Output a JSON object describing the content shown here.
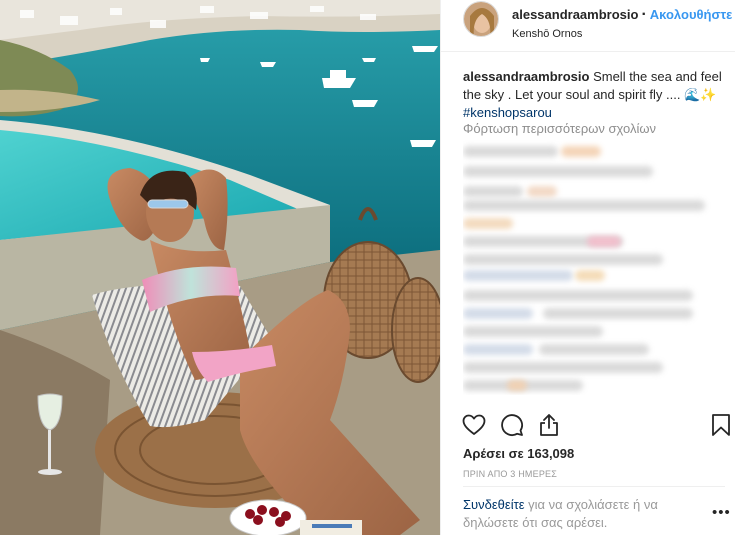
{
  "post": {
    "username": "alessandraambrosio",
    "follow_label": "Ακολουθήστε",
    "location": "Kenshō Ornos",
    "caption_user": "alessandraambrosio",
    "caption_text": "Smell the sea and feel the sky . Let your soul and spirit fly ....",
    "caption_emoji": "🌊✨",
    "hashtag": "#kenshopsarou",
    "load_more_comments": "Φόρτωση περισσότερων σχολίων",
    "likes": "Αρέσει σε 163,098",
    "timestamp": "ΠΡΙΝ ΑΠΟ 3 ΗΜΕΡΕΣ",
    "login_link": "Συνδεθείτε",
    "login_prompt": "για να σχολιάσετε ή να δηλώσετε ότι σας αρέσει.",
    "more_options": "•••"
  },
  "icons": {
    "like": "heart-outline-icon",
    "comment": "speech-bubble-icon",
    "share": "share-upload-icon",
    "save": "bookmark-icon",
    "options": "more-options-icon"
  },
  "colors": {
    "link_blue": "#3897f0",
    "hashtag_blue": "#003569",
    "secondary_text": "#8e8e8e",
    "sea": "#1c8f9c"
  }
}
